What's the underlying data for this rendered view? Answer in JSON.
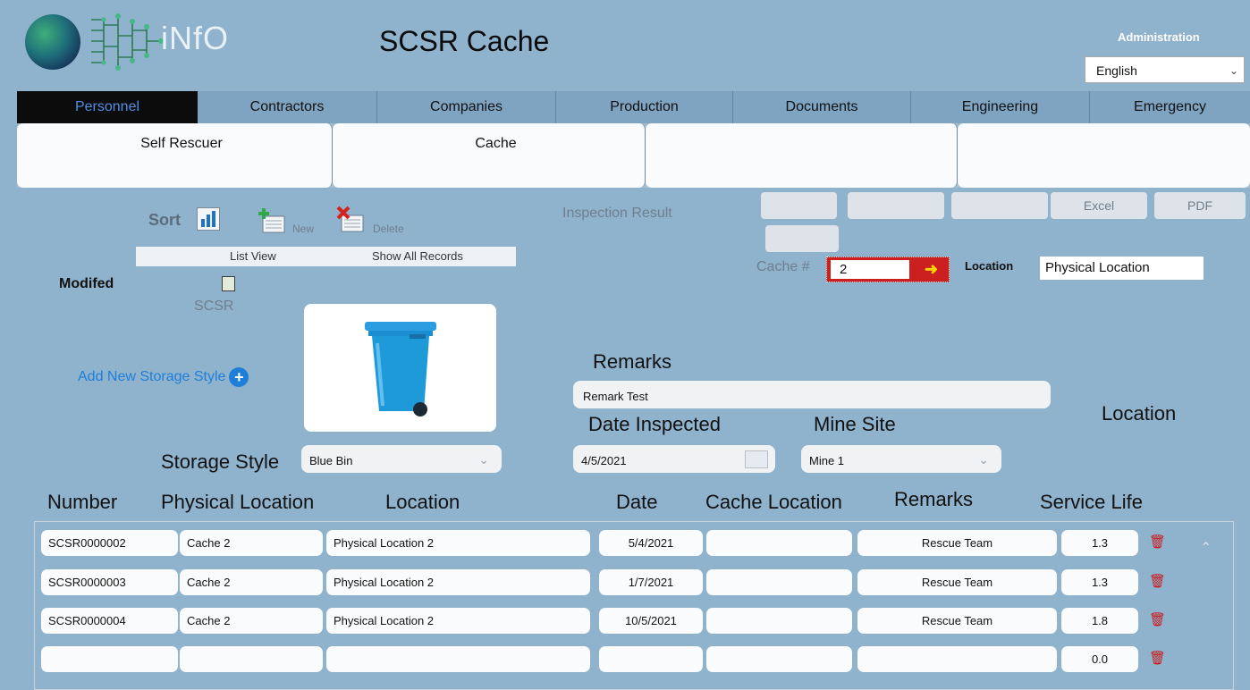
{
  "header": {
    "logo_text": "iNfO",
    "title": "SCSR Cache",
    "admin_label": "Administration",
    "language": {
      "selected": "English"
    }
  },
  "nav": {
    "tabs": [
      {
        "label": "Personnel",
        "active": true
      },
      {
        "label": "Contractors"
      },
      {
        "label": "Companies"
      },
      {
        "label": "Production"
      },
      {
        "label": "Documents"
      },
      {
        "label": "Engineering"
      },
      {
        "label": "Emergency"
      }
    ]
  },
  "subnav": {
    "items": [
      {
        "label": "Self Rescuer"
      },
      {
        "label": "Cache"
      },
      {
        "label": ""
      },
      {
        "label": ""
      }
    ]
  },
  "toolbar": {
    "sort_label": "Sort",
    "new_label": "New",
    "delete_label": "Delete",
    "list_view_label": "List View",
    "show_all_label": "Show All Records",
    "inspection_result_label": "Inspection Result",
    "excel_label": "Excel",
    "pdf_label": "PDF"
  },
  "left": {
    "modified_label": "Modifed",
    "scsr_label": "SCSR",
    "add_style_label": "Add New Storage Style",
    "storage_style_label": "Storage Style",
    "storage_style_value": "Blue Bin"
  },
  "cache": {
    "label": "Cache #",
    "value": "2",
    "location_label": "Location",
    "location_value": "Physical Location"
  },
  "form": {
    "remarks_label": "Remarks",
    "remarks_value": "Remark Test",
    "date_inspected_label": "Date Inspected",
    "date_inspected_value": "4/5/2021",
    "mine_site_label": "Mine Site",
    "mine_site_value": "Mine 1",
    "location_heading": "Location"
  },
  "table": {
    "headers": {
      "number": "Number",
      "physical_location": "Physical Location",
      "location": "Location",
      "date": "Date",
      "cache_location": "Cache Location",
      "remarks": "Remarks",
      "service_life": "Service Life"
    },
    "rows": [
      {
        "number": "SCSR0000002",
        "physical_location": "Cache 2",
        "location": "Physical Location 2",
        "date": "5/4/2021",
        "cache_location": "",
        "remarks": "Rescue Team",
        "service_life": "1.3"
      },
      {
        "number": "SCSR0000003",
        "physical_location": "Cache 2",
        "location": "Physical Location 2",
        "date": "1/7/2021",
        "cache_location": "",
        "remarks": "Rescue Team",
        "service_life": "1.3"
      },
      {
        "number": "SCSR0000004",
        "physical_location": "Cache 2",
        "location": "Physical Location 2",
        "date": "10/5/2021",
        "cache_location": "",
        "remarks": "Rescue Team",
        "service_life": "1.8"
      },
      {
        "number": "",
        "physical_location": "",
        "location": "",
        "date": "",
        "cache_location": "",
        "remarks": "",
        "service_life": "0.0"
      }
    ]
  },
  "icons": {
    "sort": "bar-chart-icon",
    "new": "new-record-icon",
    "delete": "delete-record-icon",
    "add": "plus-circle-icon",
    "trash": "trash-icon",
    "calendar": "calendar-icon",
    "arrow": "arrow-right-icon",
    "chevron": "chevron-down-icon"
  },
  "colors": {
    "background": "#8fb2cd",
    "nav_active_bg": "#0c0c0c",
    "nav_active_text": "#4f8fe5",
    "cache_box": "#cc1f1f",
    "link": "#1f7fd8",
    "trash": "#cc1a1a"
  }
}
